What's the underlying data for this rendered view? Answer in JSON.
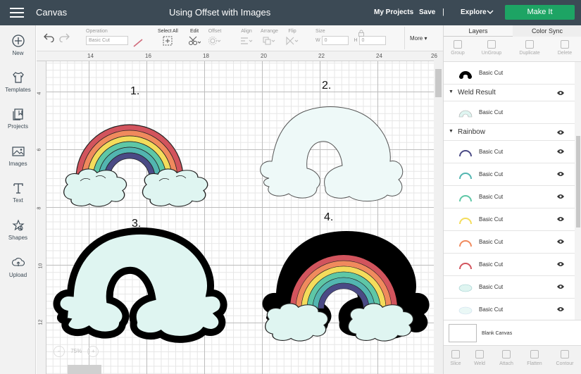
{
  "topbar": {
    "app_title": "Canvas",
    "doc_title": "Using Offset with Images",
    "my_projects": "My Projects",
    "save": "Save",
    "separator": "|",
    "explore": "Explore",
    "make_it": "Make It"
  },
  "leftnav": {
    "items": [
      {
        "label": "New",
        "icon": "plus-circle-icon"
      },
      {
        "label": "Templates",
        "icon": "shirt-icon"
      },
      {
        "label": "Projects",
        "icon": "projects-icon"
      },
      {
        "label": "Images",
        "icon": "image-icon"
      },
      {
        "label": "Text",
        "icon": "text-icon"
      },
      {
        "label": "Shapes",
        "icon": "shapes-icon"
      },
      {
        "label": "Upload",
        "icon": "upload-icon"
      }
    ]
  },
  "toolbar": {
    "operation_label": "Operation",
    "operation_value": "Basic Cut",
    "select_all": "Select All",
    "edit": "Edit",
    "offset": "Offset",
    "align": "Align",
    "arrange": "Arrange",
    "flip": "Flip",
    "size": "Size",
    "w_label": "W",
    "w_value": "0",
    "h_label": "H",
    "h_value": "0",
    "more": "More"
  },
  "rulers": {
    "h": [
      "14",
      "16",
      "18",
      "20",
      "22",
      "24",
      "26"
    ],
    "v": [
      "4",
      "6",
      "8",
      "10",
      "12"
    ]
  },
  "canvas": {
    "labels": [
      "1.",
      "2.",
      "3.",
      "4."
    ],
    "zoom_value": "75%",
    "zoom_minus": "−",
    "zoom_plus": "+"
  },
  "colors": {
    "red": "#d2545d",
    "orange": "#f08a5d",
    "yellow": "#f4dc5b",
    "green": "#5ec7a6",
    "teal": "#52b5b0",
    "purple": "#4a4a85",
    "cloud": "#dff5f1",
    "accent_green": "#1da464",
    "topbar": "#3c4a55"
  },
  "panel": {
    "tab_layers": "Layers",
    "tab_color_sync": "Color Sync",
    "actions": [
      "Group",
      "UnGroup",
      "Duplicate",
      "Delete"
    ],
    "layers": [
      {
        "kind": "row",
        "name": "Basic Cut",
        "swatch": "black-rainbow"
      },
      {
        "kind": "group",
        "name": "Weld Result"
      },
      {
        "kind": "row",
        "name": "Basic Cut",
        "swatch": "weld-rainbow"
      },
      {
        "kind": "group",
        "name": "Rainbow"
      },
      {
        "kind": "row",
        "name": "Basic Cut",
        "swatch": "purple-arc"
      },
      {
        "kind": "row",
        "name": "Basic Cut",
        "swatch": "teal-arc"
      },
      {
        "kind": "row",
        "name": "Basic Cut",
        "swatch": "green-arc"
      },
      {
        "kind": "row",
        "name": "Basic Cut",
        "swatch": "yellow-arc"
      },
      {
        "kind": "row",
        "name": "Basic Cut",
        "swatch": "orange-arc"
      },
      {
        "kind": "row",
        "name": "Basic Cut",
        "swatch": "red-arc"
      },
      {
        "kind": "row",
        "name": "Basic Cut",
        "swatch": "cloud-detail"
      },
      {
        "kind": "row",
        "name": "Basic Cut",
        "swatch": "cloud-fill"
      }
    ],
    "blank_canvas": "Blank Canvas",
    "bottom_actions": [
      "Slice",
      "Weld",
      "Attach",
      "Flatten",
      "Contour"
    ]
  }
}
